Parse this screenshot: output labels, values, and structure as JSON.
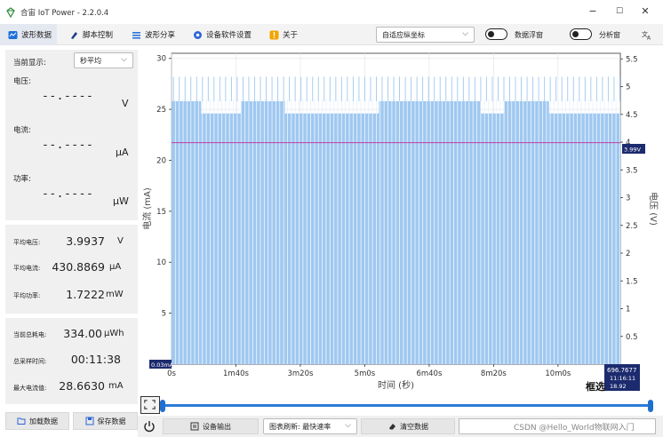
{
  "window": {
    "title": "合宙 IoT Power - 2.2.0.4",
    "minimize": "−",
    "maximize": "☐",
    "close": "✕"
  },
  "toolbar": {
    "tabs": [
      {
        "label": "波形数据",
        "icon": "wave-icon",
        "color": "#1e6fd9"
      },
      {
        "label": "脚本控制",
        "icon": "script-icon",
        "color": "#1e3a8a"
      },
      {
        "label": "波形分享",
        "icon": "list-icon",
        "color": "#2b73d8"
      },
      {
        "label": "设备软件设置",
        "icon": "gear-icon",
        "color": "#2b63d8"
      },
      {
        "label": "关于",
        "icon": "info-icon",
        "color": "#f2a400"
      }
    ],
    "axis_mode": "自适应纵坐标",
    "data_float_label": "数据浮窗",
    "analysis_label": "分析窗",
    "translate_icon": "translate-icon"
  },
  "left": {
    "display_label": "当前显示:",
    "display_mode": "秒平均",
    "voltage_label": "电压:",
    "voltage_value": "--.----",
    "voltage_unit": "V",
    "current_label": "电流:",
    "current_value": "--.----",
    "current_unit": "μA",
    "power_label": "功率:",
    "power_value": "--.----",
    "power_unit": "μW",
    "avg_voltage_label": "平均电压:",
    "avg_voltage": "3.9937",
    "avg_voltage_unit": "V",
    "avg_current_label": "平均电流:",
    "avg_current": "430.8869",
    "avg_current_unit": "μA",
    "avg_power_label": "平均功率:",
    "avg_power": "1.7222",
    "avg_power_unit": "mW",
    "total_energy_label": "当前总耗电:",
    "total_energy": "334.00",
    "total_energy_unit": "μWh",
    "sample_time_label": "总采样时间:",
    "sample_time": "00:11:38",
    "max_current_label": "最大电流值:",
    "max_current": "28.6630",
    "max_current_unit": "mA",
    "load_button": "加载数据",
    "save_button": "保存数据"
  },
  "bottom": {
    "power_icon": "power-icon",
    "device_output": "设备输出",
    "refresh_mode": "图表刷新: 最快速率",
    "clear_button": "清空数据"
  },
  "chart_overlay": {
    "min_label": "0.03mA",
    "voltage_marker": "3.99V",
    "cursor_value": "696.7677",
    "cursor_time": "11:16:11",
    "cursor_extra": "18.92",
    "box_select": "框选",
    "watermark": "CSDN @Hello_World物联网入门"
  },
  "chart_data": {
    "type": "bar",
    "xlabel": "时间 (秒)",
    "ylabel": "电流 (mA)",
    "y2label": "电压 (V)",
    "x_ticks": [
      "0s",
      "1m40s",
      "3m20s",
      "5m0s",
      "6m40s",
      "8m20s",
      "10m0s"
    ],
    "x_tick_seconds": [
      0,
      100,
      200,
      300,
      400,
      500,
      600
    ],
    "xlim": [
      0,
      696.77
    ],
    "ylim": [
      0,
      30.5
    ],
    "y_ticks": [
      5,
      10,
      15,
      20,
      25,
      30
    ],
    "y2lim": [
      0,
      5.6
    ],
    "y2_ticks": [
      0.5,
      1,
      1.5,
      2,
      2.5,
      3,
      3.5,
      4,
      4.5,
      5,
      5.5
    ],
    "voltage_line": 3.99,
    "series": [
      {
        "name": "电流",
        "color": "#9fc8f0",
        "segments": [
          {
            "x": [
              0,
              46
            ],
            "value": 25.8
          },
          {
            "x": [
              46,
              108
            ],
            "value": 24.6
          },
          {
            "x": [
              108,
              176
            ],
            "value": 25.8
          },
          {
            "x": [
              176,
              322
            ],
            "value": 24.6
          },
          {
            "x": [
              322,
              480
            ],
            "value": 25.8
          },
          {
            "x": [
              480,
              517
            ],
            "value": 24.6
          },
          {
            "x": [
              517,
              586
            ],
            "value": 25.8
          },
          {
            "x": [
              586,
              697
            ],
            "value": 24.6
          }
        ],
        "spike_value": 28.2,
        "gap_interval_s": 6
      }
    ],
    "grid": true
  }
}
